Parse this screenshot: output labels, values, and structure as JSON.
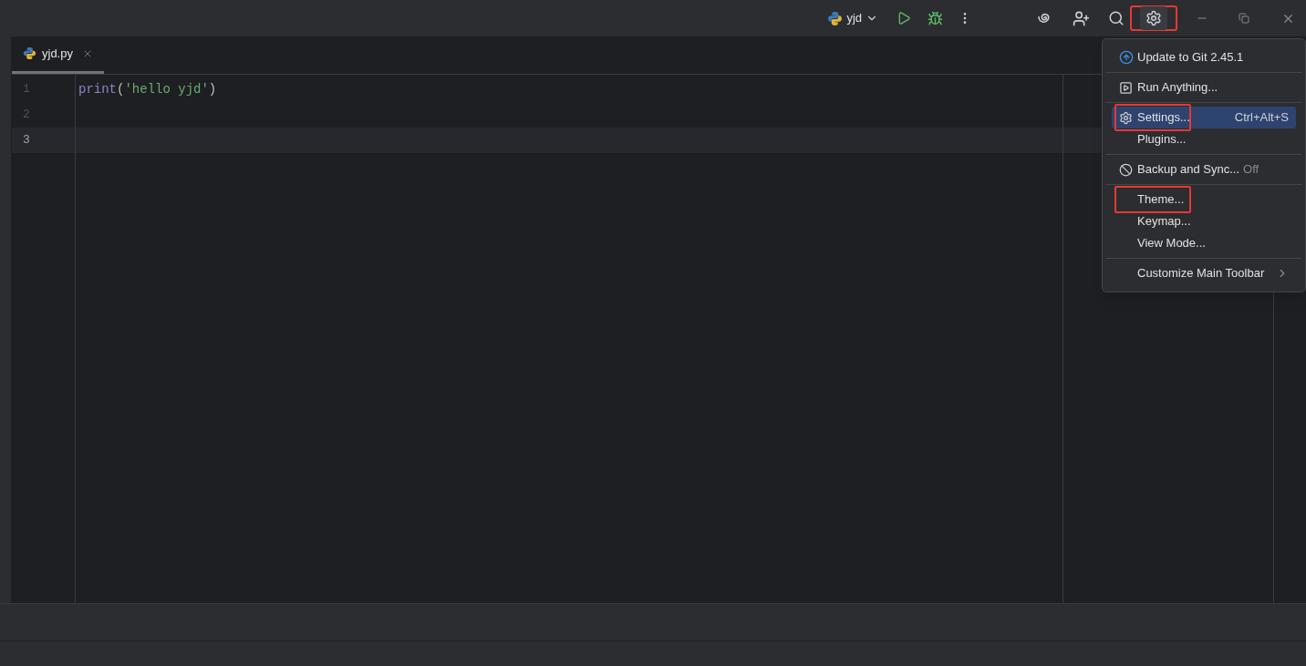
{
  "toolbar": {
    "run_config": {
      "label": "yjd"
    },
    "settings_annotated": true
  },
  "tabs": [
    {
      "label": "yjd.py",
      "selected": true
    }
  ],
  "editor": {
    "lines": [
      {
        "number": "1",
        "current": false,
        "tokens": [
          {
            "kind": "builtin",
            "text": "print"
          },
          {
            "kind": "punct",
            "text": "("
          },
          {
            "kind": "string",
            "text": "'hello yjd'"
          },
          {
            "kind": "punct",
            "text": ")"
          }
        ]
      },
      {
        "number": "2",
        "current": false
      },
      {
        "number": "3",
        "current": true
      }
    ]
  },
  "menu": {
    "groups": [
      [
        {
          "kind": "update",
          "label": "Update to Git 2.45.1",
          "selected": false,
          "annotated": false
        }
      ],
      [
        {
          "kind": "run",
          "label": "Run Anything...",
          "selected": false,
          "annotated": false
        }
      ],
      [
        {
          "kind": "settings",
          "label": "Settings...",
          "shortcut": "Ctrl+Alt+S",
          "selected": true,
          "annotated": true
        },
        {
          "kind": "plain",
          "label": "Plugins...",
          "selected": false,
          "annotated": false
        }
      ],
      [
        {
          "kind": "sync",
          "label": "Backup and Sync...",
          "status": "Off",
          "selected": false,
          "annotated": false
        }
      ],
      [
        {
          "kind": "plain",
          "label": "Theme...",
          "selected": false,
          "annotated": true
        },
        {
          "kind": "plain",
          "label": "Keymap...",
          "selected": false,
          "annotated": false
        },
        {
          "kind": "plain",
          "label": "View Mode...",
          "selected": false,
          "annotated": false
        }
      ],
      [
        {
          "kind": "submenu",
          "label": "Customize Main Toolbar",
          "selected": false,
          "annotated": false
        }
      ]
    ]
  }
}
